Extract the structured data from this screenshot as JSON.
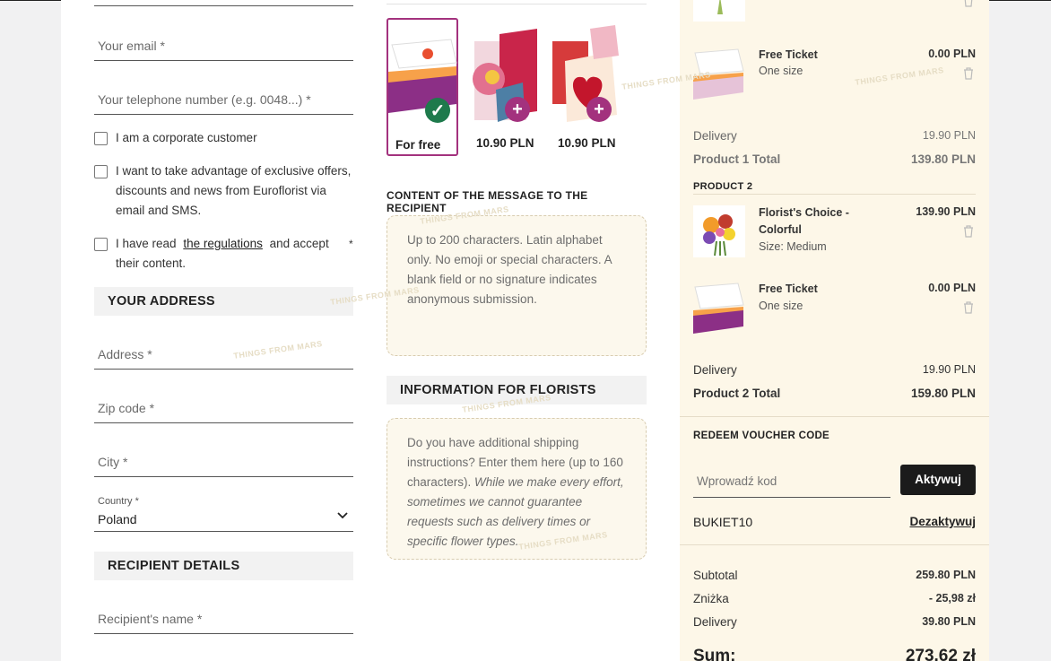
{
  "contact": {
    "email_placeholder": "Your email *",
    "phone_placeholder": "Your telephone number (e.g. 0048...) *"
  },
  "checkboxes": {
    "corporate": "I am a corporate customer",
    "offers": "I want to take advantage of exclusive offers, discounts and news from Euroflorist via email and SMS.",
    "regulations_prefix": "I have read",
    "regulations_link": "the regulations",
    "regulations_suffix": "and accept their content.",
    "regulations_required": "*"
  },
  "address": {
    "heading": "YOUR ADDRESS",
    "address_placeholder": "Address *",
    "zip_placeholder": "Zip code *",
    "city_placeholder": "City *",
    "country_label": "Country *",
    "country_value": "Poland"
  },
  "recipient": {
    "heading": "RECIPIENT DETAILS",
    "name_placeholder": "Recipient's name *"
  },
  "cards": [
    {
      "price": "For free",
      "selected": true
    },
    {
      "price": "10.90 PLN",
      "selected": false
    },
    {
      "price": "10.90 PLN",
      "selected": false
    }
  ],
  "message": {
    "title": "CONTENT OF THE MESSAGE TO THE RECIPIENT",
    "placeholder": "Up to 200 characters. Latin alphabet only. No emoji or special characters. A blank field or no signature indicates anonymous submission."
  },
  "florists": {
    "heading": "INFORMATION FOR FLORISTS",
    "text": "Do you have additional shipping instructions? Enter them here (up to 160 characters).",
    "italic": "While we make every effort, sometimes we cannot guarantee requests such as delivery times or specific flower types."
  },
  "summary": {
    "p1_ticket_name": "Free Ticket",
    "p1_ticket_size": "One size",
    "p1_ticket_price": "0.00 PLN",
    "delivery_label": "Delivery",
    "p1_delivery": "19.90 PLN",
    "p1_total_label": "Product 1 Total",
    "p1_total": "139.80 PLN",
    "p2_heading": "PRODUCT 2",
    "p2_name": "Florist's Choice - Colorful",
    "p2_size": "Size: Medium",
    "p2_price": "139.90 PLN",
    "p2_ticket_name": "Free Ticket",
    "p2_ticket_size": "One size",
    "p2_ticket_price": "0.00 PLN",
    "p2_delivery": "19.90 PLN",
    "p2_total_label": "Product 2 Total",
    "p2_total": "159.80 PLN",
    "voucher_heading": "REDEEM VOUCHER CODE",
    "voucher_placeholder": "Wprowadź kod",
    "voucher_button": "Aktywuj",
    "applied_code": "BUKIET10",
    "deactivate": "Dezaktywuj",
    "subtotal_label": "Subtotal",
    "subtotal": "259.80 PLN",
    "discount_label": "Zniżka",
    "discount": "- 25,98 zł",
    "delivery_total_label": "Delivery",
    "delivery_total": "39.80 PLN",
    "sum_label": "Sum:",
    "sum": "273.62 zł"
  },
  "watermark": "THINGS FROM MARS",
  "colors": {
    "accent": "#a3327e",
    "check": "#1e7a4c",
    "panel": "#fdf7e8"
  }
}
